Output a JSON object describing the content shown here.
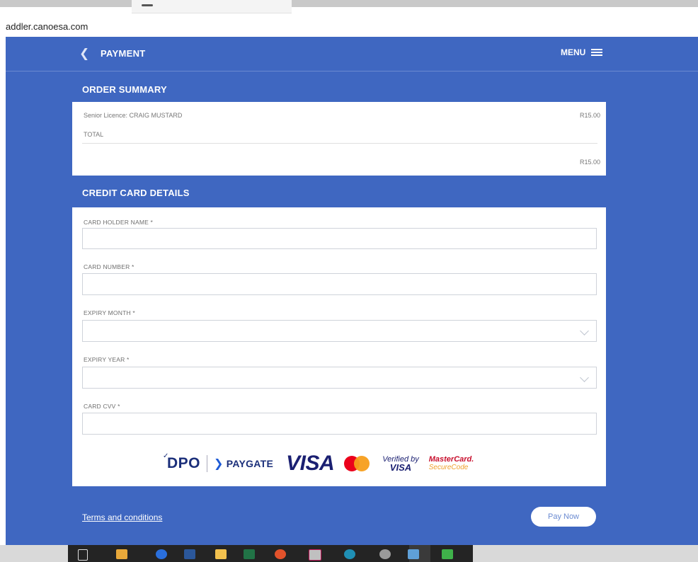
{
  "browser": {
    "url": "addler.canoesa.com"
  },
  "header": {
    "title": "PAYMENT",
    "menu_label": "MENU"
  },
  "order_summary": {
    "title": "ORDER SUMMARY",
    "items": [
      {
        "label": "Senior Licence: CRAIG MUSTARD",
        "amount": "R15.00"
      }
    ],
    "total_label": "TOTAL",
    "total_amount": "R15.00"
  },
  "credit_card": {
    "title": "CREDIT CARD DETAILS",
    "fields": {
      "holder_name": {
        "label": "CARD HOLDER NAME *",
        "value": ""
      },
      "card_number": {
        "label": "CARD NUMBER *",
        "value": ""
      },
      "expiry_month": {
        "label": "EXPIRY MONTH *",
        "value": ""
      },
      "expiry_year": {
        "label": "EXPIRY YEAR *",
        "value": ""
      },
      "cvv": {
        "label": "CARD CVV *",
        "value": ""
      }
    },
    "logos": {
      "dpo": "DPO",
      "paygate": "PAYGATE",
      "visa": "VISA",
      "verified_by": "Verified by",
      "verified_visa": "VISA",
      "mastercard": "MasterCard.",
      "securecode": "SecureCode"
    }
  },
  "footer": {
    "terms_label": "Terms and conditions",
    "pay_label": "Pay Now"
  },
  "colors": {
    "app_background": "#3f67c1",
    "card_background": "#ffffff",
    "visa_blue": "#1a1f71",
    "mastercard_red": "#eb001b",
    "mastercard_orange": "#f79e1b"
  },
  "icons": {
    "back": "chevron-left-icon",
    "menu": "hamburger-icon",
    "select": "chevron-down-icon"
  }
}
